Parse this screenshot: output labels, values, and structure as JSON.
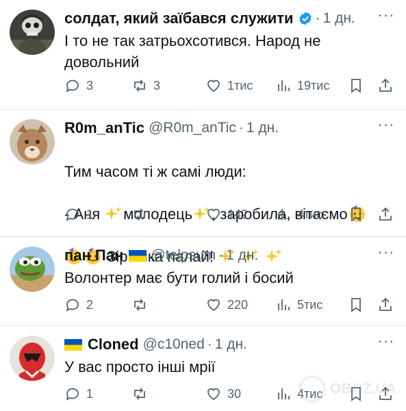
{
  "comments": [
    {
      "name": "солдат, який заїбався служити",
      "handle": "",
      "time": "1 дн.",
      "verified": true,
      "text": "І то не так затрьохсотився. Народ не довольний",
      "replies": "3",
      "retweets": "3",
      "likes": "1тис",
      "views": "19тис",
      "avatar": "soldier-avatar-icon"
    },
    {
      "name": "R0m_anTic",
      "handle": "@R0m_anTic",
      "time": "1 дн.",
      "text_line1": "Тим часом ті ж самі люди:",
      "text_line2_a": "- Аня ",
      "text_line2_b": "молодець",
      "text_line2_c": ", заробила, вітаємо",
      "text_line3": " Зір очка палай! ",
      "replies": "1",
      "retweets": "",
      "likes": "142",
      "views": "4тис",
      "avatar": "cougar-avatar-icon"
    },
    {
      "name": "пан Пан",
      "handle": "@telpsum",
      "time": "1 дн.",
      "text": "Волонтер має бути голий і босий",
      "replies": "2",
      "retweets": "",
      "likes": "220",
      "views": "5тис",
      "avatar": "pepe-frog-avatar-icon"
    },
    {
      "name": "Cloned",
      "handle": "@c10ned",
      "time": "1 дн.",
      "text": "У вас просто інші мрії",
      "replies": "1",
      "retweets": "",
      "likes": "30",
      "views": "4тис",
      "avatar": "red-ranger-avatar-icon"
    }
  ],
  "separator": "·",
  "more_label": "···",
  "watermark": "OBOZ.UA",
  "colors": {
    "text": "#0f1419",
    "muted": "#536471",
    "verified": "#1d9bf0",
    "flag_blue": "#0057b7",
    "flag_yellow": "#ffd700"
  }
}
